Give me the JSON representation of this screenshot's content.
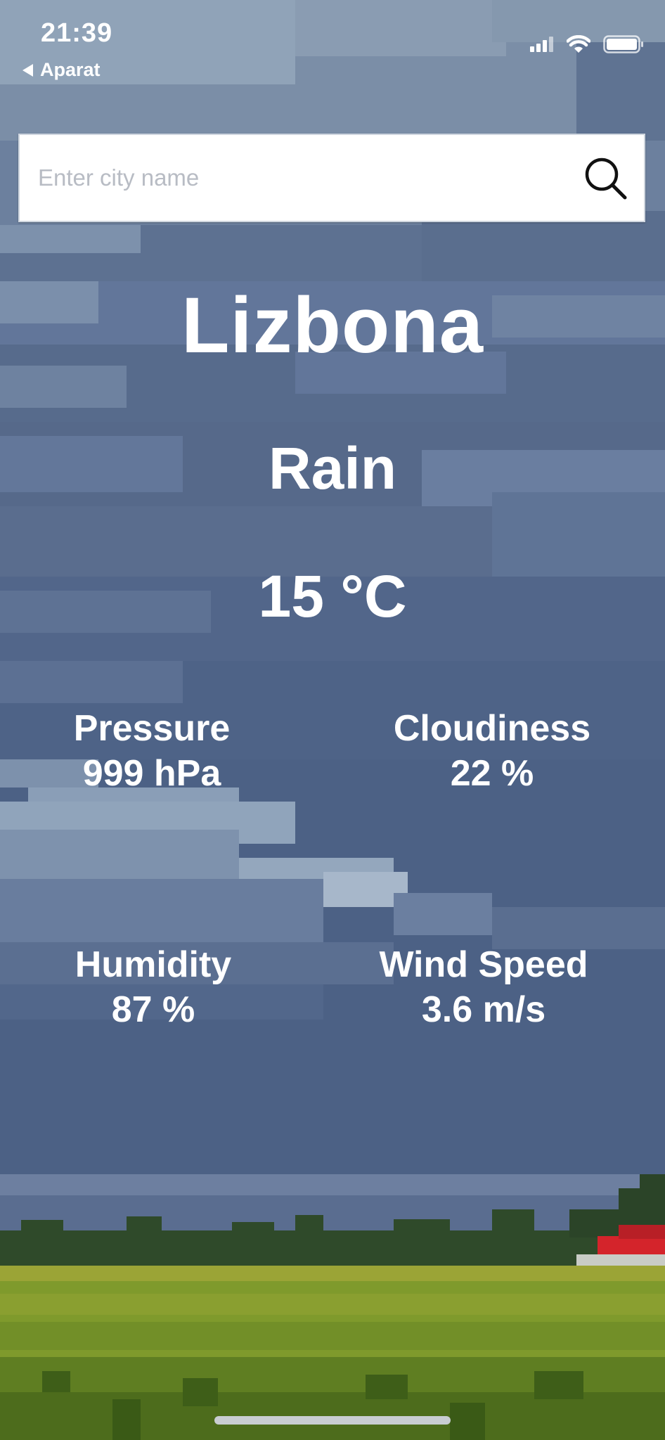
{
  "status_bar": {
    "time": "21:39",
    "back_label": "Aparat",
    "signal_icon": "cellular-signal-icon",
    "wifi_icon": "wifi-icon",
    "battery_icon": "battery-icon"
  },
  "search": {
    "placeholder": "Enter city name",
    "value": "",
    "icon": "search-icon"
  },
  "weather": {
    "city": "Lizbona",
    "condition": "Rain",
    "temperature": "15 °C",
    "stats": {
      "pressure": {
        "label": "Pressure",
        "value": "999 hPa"
      },
      "cloudiness": {
        "label": "Cloudiness",
        "value": "22 %"
      },
      "humidity": {
        "label": "Humidity",
        "value": "87 %"
      },
      "wind_speed": {
        "label": "Wind Speed",
        "value": "3.6 m/s"
      }
    }
  },
  "colors": {
    "sky": "#4c6185",
    "cloud_light": "#8ea3b8",
    "cloud_mid": "#6d819e",
    "cloud_dark": "#56698a",
    "grass": "#7f9a2c",
    "text": "#ffffff"
  }
}
